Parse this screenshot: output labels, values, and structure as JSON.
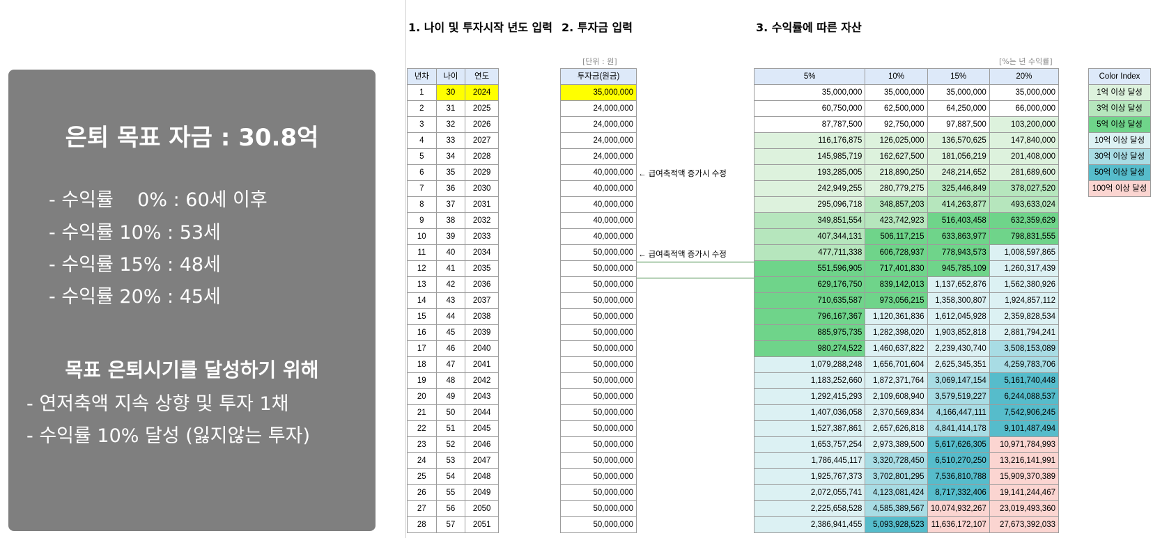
{
  "panel": {
    "title": "은퇴 목표 자금 : 30.8억",
    "lines": [
      "- 수익률    0% : 60세 이후",
      "- 수익률 10% : 53세",
      "- 수익률 15% : 48세",
      "- 수익률 20% : 45세"
    ],
    "goal_head": "목표 은퇴시기를 달성하기 위해",
    "goal_lines": [
      "- 연저축액 지속 상향 및 투자 1채",
      "- 수익률 10% 달성 (잃지않는 투자)"
    ]
  },
  "sheet": {
    "section1": "1. 나이 및 투자시작 년도 입력",
    "section2": "2. 투자금 입력",
    "section3": "3. 수익률에 따른 자산",
    "unit_label": "[단위 : 원]",
    "rate_label": "[%는 년 수익률]",
    "headers1": [
      "년차",
      "나이",
      "연도"
    ],
    "header2": "투자금(원금)",
    "headers3": [
      "5%",
      "10%",
      "15%",
      "20%"
    ],
    "note": "← 급여축적액 증가시 수정",
    "rows": [
      [
        "1",
        "30",
        "2024",
        "35,000,000",
        "35,000,000",
        "35,000,000",
        "35,000,000",
        "35,000,000"
      ],
      [
        "2",
        "31",
        "2025",
        "24,000,000",
        "60,750,000",
        "62,500,000",
        "64,250,000",
        "66,000,000"
      ],
      [
        "3",
        "32",
        "2026",
        "24,000,000",
        "87,787,500",
        "92,750,000",
        "97,887,500",
        "103,200,000"
      ],
      [
        "4",
        "33",
        "2027",
        "24,000,000",
        "116,176,875",
        "126,025,000",
        "136,570,625",
        "147,840,000"
      ],
      [
        "5",
        "34",
        "2028",
        "24,000,000",
        "145,985,719",
        "162,627,500",
        "181,056,219",
        "201,408,000"
      ],
      [
        "6",
        "35",
        "2029",
        "40,000,000",
        "193,285,005",
        "218,890,250",
        "248,214,652",
        "281,689,600"
      ],
      [
        "7",
        "36",
        "2030",
        "40,000,000",
        "242,949,255",
        "280,779,275",
        "325,446,849",
        "378,027,520"
      ],
      [
        "8",
        "37",
        "2031",
        "40,000,000",
        "295,096,718",
        "348,857,203",
        "414,263,877",
        "493,633,024"
      ],
      [
        "9",
        "38",
        "2032",
        "40,000,000",
        "349,851,554",
        "423,742,923",
        "516,403,458",
        "632,359,629"
      ],
      [
        "10",
        "39",
        "2033",
        "40,000,000",
        "407,344,131",
        "506,117,215",
        "633,863,977",
        "798,831,555"
      ],
      [
        "11",
        "40",
        "2034",
        "50,000,000",
        "477,711,338",
        "606,728,937",
        "778,943,573",
        "1,008,597,865"
      ],
      [
        "12",
        "41",
        "2035",
        "50,000,000",
        "551,596,905",
        "717,401,830",
        "945,785,109",
        "1,260,317,439"
      ],
      [
        "13",
        "42",
        "2036",
        "50,000,000",
        "629,176,750",
        "839,142,013",
        "1,137,652,876",
        "1,562,380,926"
      ],
      [
        "14",
        "43",
        "2037",
        "50,000,000",
        "710,635,587",
        "973,056,215",
        "1,358,300,807",
        "1,924,857,112"
      ],
      [
        "15",
        "44",
        "2038",
        "50,000,000",
        "796,167,367",
        "1,120,361,836",
        "1,612,045,928",
        "2,359,828,534"
      ],
      [
        "16",
        "45",
        "2039",
        "50,000,000",
        "885,975,735",
        "1,282,398,020",
        "1,903,852,818",
        "2,881,794,241"
      ],
      [
        "17",
        "46",
        "2040",
        "50,000,000",
        "980,274,522",
        "1,460,637,822",
        "2,239,430,740",
        "3,508,153,089"
      ],
      [
        "18",
        "47",
        "2041",
        "50,000,000",
        "1,079,288,248",
        "1,656,701,604",
        "2,625,345,351",
        "4,259,783,706"
      ],
      [
        "19",
        "48",
        "2042",
        "50,000,000",
        "1,183,252,660",
        "1,872,371,764",
        "3,069,147,154",
        "5,161,740,448"
      ],
      [
        "20",
        "49",
        "2043",
        "50,000,000",
        "1,292,415,293",
        "2,109,608,940",
        "3,579,519,227",
        "6,244,088,537"
      ],
      [
        "21",
        "50",
        "2044",
        "50,000,000",
        "1,407,036,058",
        "2,370,569,834",
        "4,166,447,111",
        "7,542,906,245"
      ],
      [
        "22",
        "51",
        "2045",
        "50,000,000",
        "1,527,387,861",
        "2,657,626,818",
        "4,841,414,178",
        "9,101,487,494"
      ],
      [
        "23",
        "52",
        "2046",
        "50,000,000",
        "1,653,757,254",
        "2,973,389,500",
        "5,617,626,305",
        "10,971,784,993"
      ],
      [
        "24",
        "53",
        "2047",
        "50,000,000",
        "1,786,445,117",
        "3,320,728,450",
        "6,510,270,250",
        "13,216,141,991"
      ],
      [
        "25",
        "54",
        "2048",
        "50,000,000",
        "1,925,767,373",
        "3,702,801,295",
        "7,536,810,788",
        "15,909,370,389"
      ],
      [
        "26",
        "55",
        "2049",
        "50,000,000",
        "2,072,055,741",
        "4,123,081,424",
        "8,717,332,406",
        "19,141,244,467"
      ],
      [
        "27",
        "56",
        "2050",
        "50,000,000",
        "2,225,658,528",
        "4,585,389,567",
        "10,074,932,267",
        "23,019,493,360"
      ],
      [
        "28",
        "57",
        "2051",
        "50,000,000",
        "2,386,941,455",
        "5,093,928,523",
        "11,636,172,107",
        "27,673,392,033"
      ]
    ],
    "color_index_title": "Color Index",
    "color_index": [
      {
        "label": "1억 이상 달성",
        "color": "#ddf2dd"
      },
      {
        "label": "3억 이상 달성",
        "color": "#b6e6bd"
      },
      {
        "label": "5억 이상 달성",
        "color": "#6fd48a"
      },
      {
        "label": "10억 이상 달성",
        "color": "#dcf1f3"
      },
      {
        "label": "30억 이상 달성",
        "color": "#a8dce4"
      },
      {
        "label": "50억 이상 달성",
        "color": "#56bccb"
      },
      {
        "label": "100억 이상 달성",
        "color": "#fbd5d1"
      }
    ]
  }
}
